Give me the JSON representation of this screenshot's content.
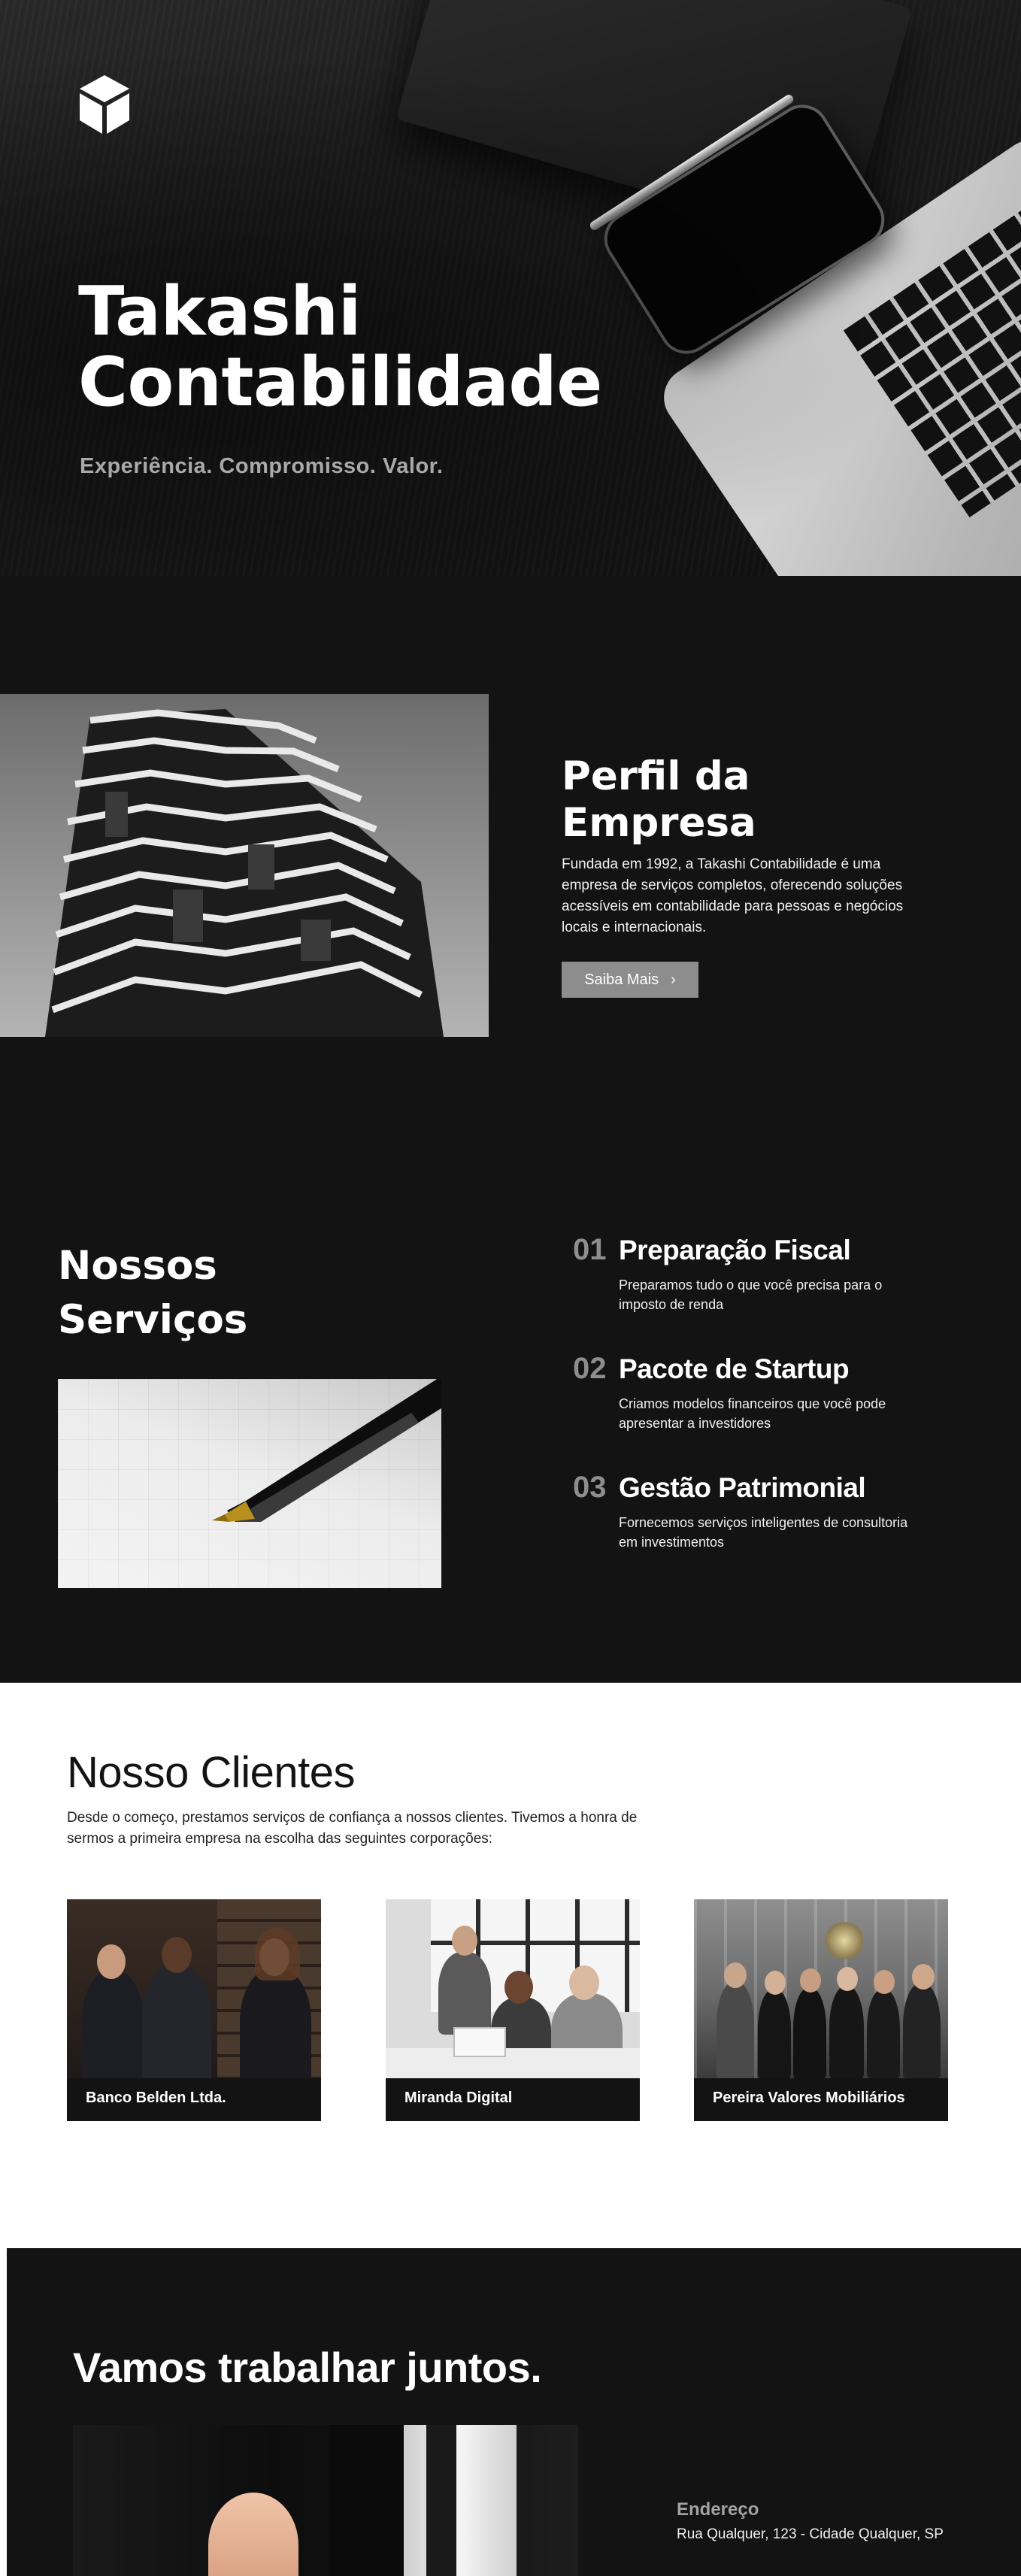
{
  "hero": {
    "title_line1": "Takashi",
    "title_line2": "Contabilidade",
    "tagline": "Experiência. Compromisso. Valor.",
    "logo_icon": "cube-icon"
  },
  "profile": {
    "heading_line1": "Perfil da",
    "heading_line2": "Empresa",
    "text": "Fundada em 1992, a Takashi Contabilidade é uma empresa de serviços completos, oferecendo soluções acessíveis em contabilidade para pessoas e negócios locais e internacionais.",
    "button_label": "Saiba Mais",
    "button_icon": "chevron-right-icon"
  },
  "services": {
    "heading_line1": "Nossos",
    "heading_line2": "Serviços",
    "items": [
      {
        "num": "01",
        "title": "Preparação Fiscal",
        "desc": "Preparamos tudo o que você precisa para o imposto de renda"
      },
      {
        "num": "02",
        "title": "Pacote de Startup",
        "desc": "Criamos modelos financeiros que você pode apresentar a investidores"
      },
      {
        "num": "03",
        "title": "Gestão Patrimonial",
        "desc": "Fornecemos serviços inteligentes de consultoria em investimentos"
      }
    ]
  },
  "clients": {
    "heading": "Nosso Clientes",
    "intro": "Desde o começo, prestamos serviços de confiança a nossos clientes. Tivemos a honra de sermos a primeira empresa na escolha das seguintes corporações:",
    "cards": [
      {
        "name": "Banco Belden Ltda."
      },
      {
        "name": "Miranda Digital"
      },
      {
        "name": "Pereira Valores Mobiliários"
      }
    ]
  },
  "contact": {
    "heading": "Vamos trabalhar juntos.",
    "address_label": "Endereço",
    "address": "Rua Qualquer, 123 - Cidade Qualquer, SP"
  },
  "colors": {
    "background_dark": "#131313",
    "background_light": "#ffffff",
    "button_gray": "#8d8d8d",
    "muted_text": "#a9a9a9"
  }
}
